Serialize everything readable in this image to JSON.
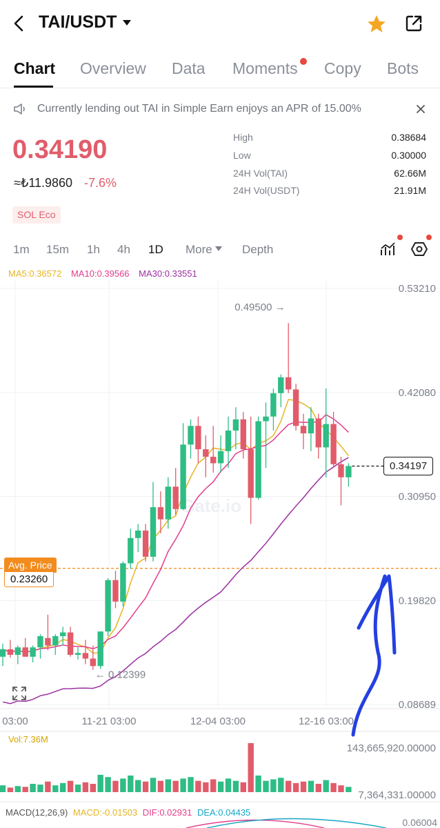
{
  "header": {
    "pair": "TAI/USDT",
    "back_icon": "chevron-left-icon",
    "dropdown_icon": "caret-down-icon",
    "favorite_icon": "star-icon",
    "share_icon": "share-icon",
    "favorite_color": "#f5a623"
  },
  "tabs": [
    {
      "label": "Chart",
      "active": true
    },
    {
      "label": "Overview"
    },
    {
      "label": "Data"
    },
    {
      "label": "Moments",
      "badge": true
    },
    {
      "label": "Copy"
    },
    {
      "label": "Bots"
    }
  ],
  "notice": {
    "text": "Currently lending out TAI in Simple Earn enjoys an APR of 15.00%",
    "icon": "speaker-icon",
    "close_icon": "close-icon"
  },
  "ticker": {
    "price": "0.34190",
    "fiat": "≈₺11.9860",
    "change": "-7.6%",
    "tag": "SOL Eco",
    "down_color": "#e15c6a",
    "up_color": "#2ebd85"
  },
  "stats": [
    {
      "label": "High",
      "value": "0.38684"
    },
    {
      "label": "Low",
      "value": "0.30000"
    },
    {
      "label": "24H Vol(TAI)",
      "value": "62.66M"
    },
    {
      "label": "24H Vol(USDT)",
      "value": "21.91M"
    }
  ],
  "timeframes": [
    {
      "label": "1m"
    },
    {
      "label": "15m"
    },
    {
      "label": "1h"
    },
    {
      "label": "4h"
    },
    {
      "label": "1D",
      "active": true
    },
    {
      "label": "More"
    },
    {
      "label": "Depth"
    }
  ],
  "indicators": {
    "ma5": "MA5:0.36572",
    "ma10": "MA10:0.39566",
    "ma30": "MA30:0.33551",
    "ma5_color": "#e6b422",
    "ma10_color": "#e23c8c",
    "ma30_color": "#9b2ea0"
  },
  "chart_data": {
    "type": "candlestick",
    "y_ticks": [
      "0.53210",
      "0.42080",
      "0.30950",
      "0.19820",
      "0.08689"
    ],
    "ylim": [
      0.08689,
      0.5321
    ],
    "x_ticks": [
      "03:00",
      "11-21 03:00",
      "12-04 03:00",
      "12-16 03:00"
    ],
    "current_price_label": "0.34197",
    "current_price": 0.34197,
    "avg_price_label": "Avg. Price",
    "avg_price": "0.23260",
    "avg_price_value": 0.2326,
    "max_label": "0.49500",
    "min_label": "0.12399",
    "watermark": "Gate.io",
    "candles": [
      {
        "o": 0.138,
        "h": 0.152,
        "l": 0.128,
        "c": 0.146
      },
      {
        "o": 0.146,
        "h": 0.156,
        "l": 0.137,
        "c": 0.14
      },
      {
        "o": 0.14,
        "h": 0.15,
        "l": 0.13,
        "c": 0.148
      },
      {
        "o": 0.148,
        "h": 0.158,
        "l": 0.138,
        "c": 0.138
      },
      {
        "o": 0.138,
        "h": 0.15,
        "l": 0.132,
        "c": 0.148
      },
      {
        "o": 0.148,
        "h": 0.162,
        "l": 0.136,
        "c": 0.16
      },
      {
        "o": 0.158,
        "h": 0.183,
        "l": 0.145,
        "c": 0.15
      },
      {
        "o": 0.15,
        "h": 0.162,
        "l": 0.14,
        "c": 0.16
      },
      {
        "o": 0.16,
        "h": 0.17,
        "l": 0.15,
        "c": 0.164
      },
      {
        "o": 0.164,
        "h": 0.17,
        "l": 0.138,
        "c": 0.14
      },
      {
        "o": 0.14,
        "h": 0.148,
        "l": 0.135,
        "c": 0.142
      },
      {
        "o": 0.142,
        "h": 0.156,
        "l": 0.13,
        "c": 0.136
      },
      {
        "o": 0.136,
        "h": 0.15,
        "l": 0.124,
        "c": 0.128
      },
      {
        "o": 0.128,
        "h": 0.165,
        "l": 0.125,
        "c": 0.165
      },
      {
        "o": 0.165,
        "h": 0.222,
        "l": 0.16,
        "c": 0.22
      },
      {
        "o": 0.22,
        "h": 0.23,
        "l": 0.19,
        "c": 0.197
      },
      {
        "o": 0.197,
        "h": 0.24,
        "l": 0.192,
        "c": 0.238
      },
      {
        "o": 0.238,
        "h": 0.275,
        "l": 0.232,
        "c": 0.265
      },
      {
        "o": 0.265,
        "h": 0.28,
        "l": 0.25,
        "c": 0.273
      },
      {
        "o": 0.273,
        "h": 0.28,
        "l": 0.24,
        "c": 0.245
      },
      {
        "o": 0.245,
        "h": 0.325,
        "l": 0.24,
        "c": 0.298
      },
      {
        "o": 0.298,
        "h": 0.315,
        "l": 0.27,
        "c": 0.285
      },
      {
        "o": 0.285,
        "h": 0.33,
        "l": 0.275,
        "c": 0.32
      },
      {
        "o": 0.32,
        "h": 0.34,
        "l": 0.29,
        "c": 0.296
      },
      {
        "o": 0.296,
        "h": 0.388,
        "l": 0.295,
        "c": 0.365
      },
      {
        "o": 0.365,
        "h": 0.392,
        "l": 0.35,
        "c": 0.385
      },
      {
        "o": 0.385,
        "h": 0.395,
        "l": 0.345,
        "c": 0.36
      },
      {
        "o": 0.36,
        "h": 0.375,
        "l": 0.33,
        "c": 0.352
      },
      {
        "o": 0.352,
        "h": 0.385,
        "l": 0.335,
        "c": 0.345
      },
      {
        "o": 0.345,
        "h": 0.375,
        "l": 0.335,
        "c": 0.358
      },
      {
        "o": 0.358,
        "h": 0.395,
        "l": 0.34,
        "c": 0.38
      },
      {
        "o": 0.38,
        "h": 0.405,
        "l": 0.36,
        "c": 0.392
      },
      {
        "o": 0.392,
        "h": 0.4,
        "l": 0.35,
        "c": 0.36
      },
      {
        "o": 0.36,
        "h": 0.395,
        "l": 0.28,
        "c": 0.308
      },
      {
        "o": 0.308,
        "h": 0.395,
        "l": 0.306,
        "c": 0.39
      },
      {
        "o": 0.39,
        "h": 0.41,
        "l": 0.34,
        "c": 0.395
      },
      {
        "o": 0.395,
        "h": 0.425,
        "l": 0.38,
        "c": 0.42
      },
      {
        "o": 0.42,
        "h": 0.44,
        "l": 0.405,
        "c": 0.437
      },
      {
        "o": 0.437,
        "h": 0.495,
        "l": 0.42,
        "c": 0.424
      },
      {
        "o": 0.424,
        "h": 0.43,
        "l": 0.38,
        "c": 0.385
      },
      {
        "o": 0.385,
        "h": 0.398,
        "l": 0.36,
        "c": 0.377
      },
      {
        "o": 0.377,
        "h": 0.405,
        "l": 0.358,
        "c": 0.393
      },
      {
        "o": 0.393,
        "h": 0.398,
        "l": 0.35,
        "c": 0.362
      },
      {
        "o": 0.362,
        "h": 0.425,
        "l": 0.33,
        "c": 0.387
      },
      {
        "o": 0.387,
        "h": 0.4,
        "l": 0.34,
        "c": 0.344
      },
      {
        "o": 0.344,
        "h": 0.352,
        "l": 0.3,
        "c": 0.33
      },
      {
        "o": 0.33,
        "h": 0.345,
        "l": 0.32,
        "c": 0.342
      }
    ],
    "volume_ticks": [
      "143,665,920.00000",
      "7,364,331.00000"
    ],
    "volume_label": "Vol:7.36M",
    "volumes": [
      18,
      12,
      16,
      14,
      22,
      20,
      28,
      18,
      24,
      30,
      20,
      26,
      22,
      46,
      40,
      30,
      36,
      44,
      32,
      28,
      38,
      30,
      34,
      30,
      36,
      40,
      30,
      26,
      34,
      28,
      36,
      30,
      26,
      130,
      44,
      30,
      34,
      38,
      30,
      24,
      28,
      30,
      22,
      32,
      24,
      18,
      14
    ],
    "macd_label": "MACD(12,26,9)",
    "macd": "MACD:-0.01503",
    "dif": "DIF:0.02931",
    "dea": "DEA:0.04435",
    "macd_tick": "0.06004"
  }
}
